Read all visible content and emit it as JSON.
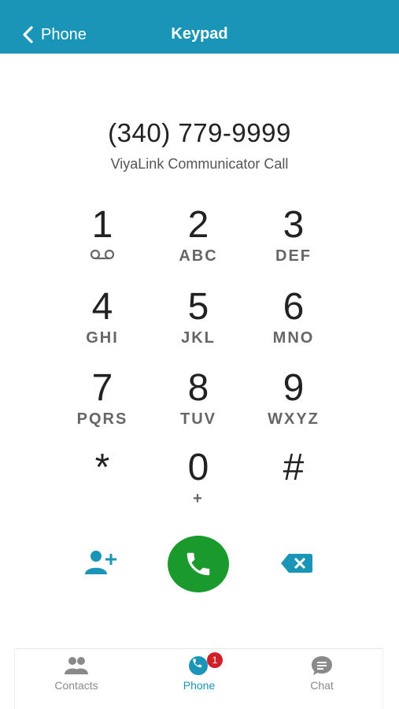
{
  "header": {
    "back_label": "Phone",
    "title": "Keypad"
  },
  "dialer": {
    "number": "(340) 779-9999",
    "subtitle": "ViyaLink Communicator Call"
  },
  "keypad": {
    "keys": [
      {
        "digit": "1",
        "letters": ""
      },
      {
        "digit": "2",
        "letters": "ABC"
      },
      {
        "digit": "3",
        "letters": "DEF"
      },
      {
        "digit": "4",
        "letters": "GHI"
      },
      {
        "digit": "5",
        "letters": "JKL"
      },
      {
        "digit": "6",
        "letters": "MNO"
      },
      {
        "digit": "7",
        "letters": "PQRS"
      },
      {
        "digit": "8",
        "letters": "TUV"
      },
      {
        "digit": "9",
        "letters": "WXYZ"
      },
      {
        "digit": "*",
        "letters": ""
      },
      {
        "digit": "0",
        "letters": "+"
      },
      {
        "digit": "#",
        "letters": ""
      }
    ]
  },
  "actions": {
    "add_contact_icon": "add-contact-icon",
    "call_icon": "phone-handset-icon",
    "backspace_icon": "backspace-icon"
  },
  "tabs": [
    {
      "label": "Contacts",
      "icon": "contacts-icon",
      "active": false
    },
    {
      "label": "Phone",
      "icon": "phone-icon",
      "active": true,
      "badge": "1"
    },
    {
      "label": "Chat",
      "icon": "chat-icon",
      "active": false
    }
  ],
  "colors": {
    "accent": "#1a95b7",
    "call_green": "#1a9a2c",
    "badge_red": "#d0212b"
  }
}
